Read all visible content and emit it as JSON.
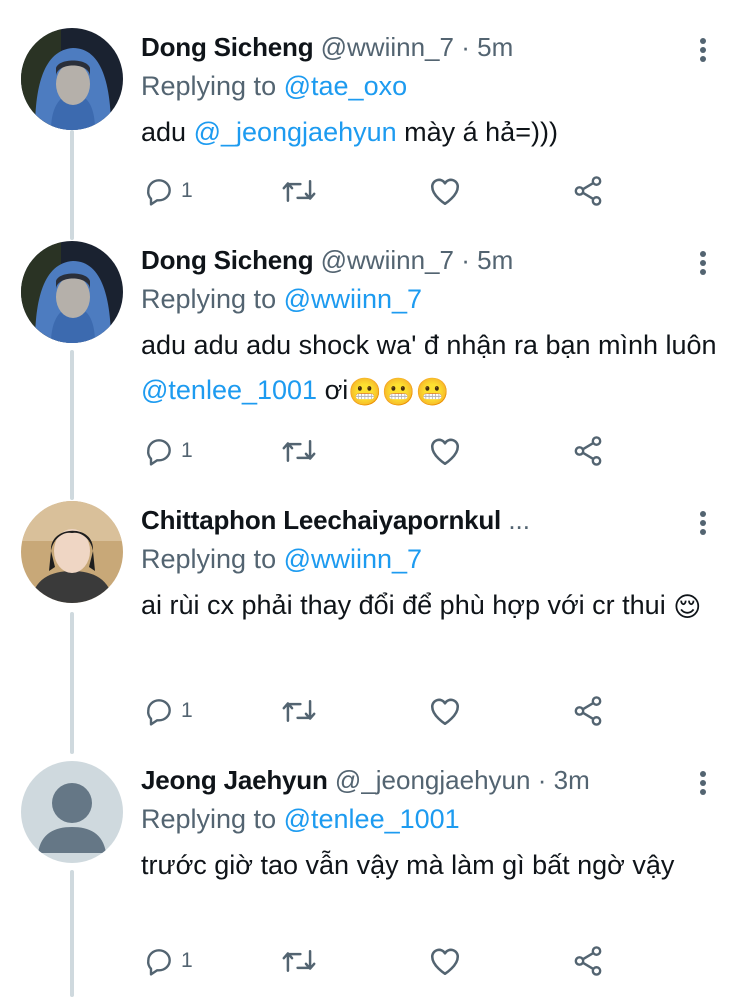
{
  "colors": {
    "link": "#1d9bf0",
    "secondary": "#536471",
    "primary": "#0f1419",
    "thread_line": "#cfd9de"
  },
  "tweets": [
    {
      "name": "Dong Sicheng",
      "handle": "@wwiinn_7",
      "dot": "·",
      "time": "5m",
      "replying_prefix": "Replying to",
      "replying_to": "@tae_oxo",
      "text_parts": [
        "adu ",
        "@_jeongjaehyun",
        " mày á hả=)))"
      ],
      "reply_count": "1",
      "avatar": "hooded-person-photo"
    },
    {
      "name": "Dong Sicheng",
      "handle": "@wwiinn_7",
      "dot": "·",
      "time": "5m",
      "replying_prefix": "Replying to",
      "replying_to": "@wwiinn_7",
      "text_parts": [
        "adu adu adu shock wa' đ nhận ra bạn mình luôn ",
        "@tenlee_1001",
        " ơi"
      ],
      "emojis": [
        "😬",
        "😬",
        "😬"
      ],
      "reply_count": "1",
      "avatar": "hooded-person-photo"
    },
    {
      "name": "Chittaphon Leechaiyapornkul",
      "ellipsis": "...",
      "replying_prefix": "Replying to",
      "replying_to": "@wwiinn_7",
      "text_parts": [
        "ai rùi cx phải thay đổi để phù hợp với cr thui "
      ],
      "emojis": [
        "😌"
      ],
      "reply_count": "1",
      "avatar": "portrait-photo"
    },
    {
      "name": "Jeong Jaehyun",
      "handle": "@_jeongjaehyun",
      "dot": "·",
      "time": "3m",
      "replying_prefix": "Replying to",
      "replying_to": "@tenlee_1001",
      "text_parts": [
        "trước giờ tao vẫn vậy mà làm gì bất ngờ vậy"
      ],
      "reply_count": "1",
      "avatar": "default-avatar"
    }
  ]
}
